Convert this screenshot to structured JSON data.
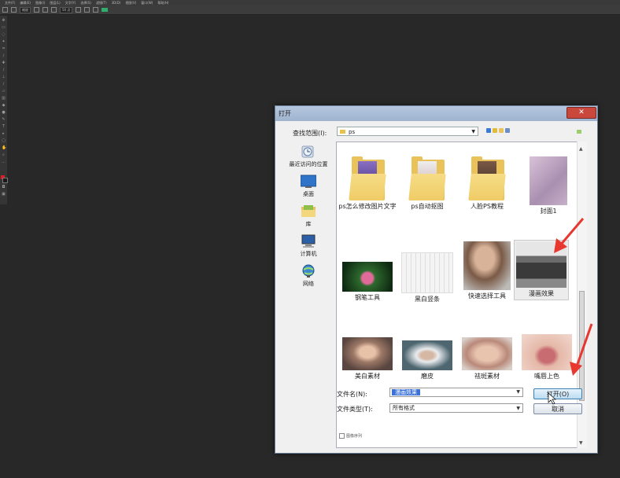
{
  "menubar": [
    "文件(F)",
    "编辑(E)",
    "图像(I)",
    "图层(L)",
    "文字(Y)",
    "选择(S)",
    "滤镜(T)",
    "3D(D)",
    "视图(V)",
    "窗口(W)",
    "帮助(H)"
  ],
  "optionsbar": {
    "field1": "缩放",
    "field2": "50 点"
  },
  "dialog": {
    "title": "打开",
    "close_glyph": "✕",
    "lookin_label": "查找范围(I):",
    "lookin_value": "ps",
    "places": [
      "最近访问的位置",
      "桌面",
      "库",
      "计算机",
      "网络"
    ],
    "files": [
      "ps怎么修改图片文字",
      "ps自动抠图",
      "人脸PS教程",
      "封面1",
      "钢笔工具",
      "黑白竖条",
      "快速选择工具",
      "漫画效果",
      "美白素材",
      "磨皮",
      "祛斑素材",
      "嘴唇上色"
    ],
    "filename_label": "文件名(N):",
    "filename_value": "漫画效果",
    "filetype_label": "文件类型(T):",
    "filetype_value": "所有格式",
    "open_button": "打开(O)",
    "cancel_button": "取消",
    "checkbox_label": "图像序列"
  },
  "colors": {
    "workspace": "#282828",
    "annotation_arrow": "#e8372e",
    "accent_selection": "#3a72d8"
  }
}
